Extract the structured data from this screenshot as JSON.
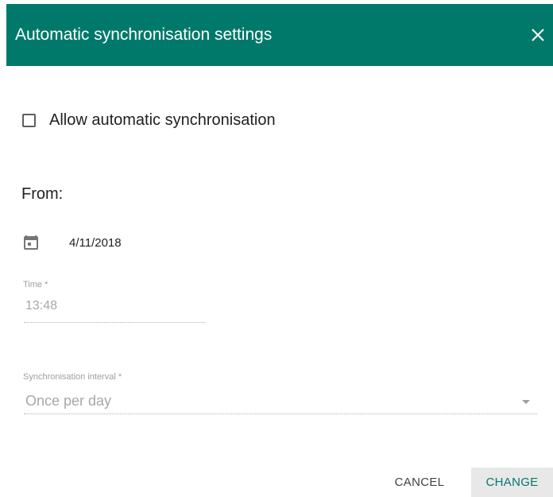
{
  "dialog": {
    "title": "Automatic synchronisation settings",
    "close_icon": "close-icon"
  },
  "auto_sync": {
    "label": "Allow automatic synchronisation",
    "checked": false
  },
  "from": {
    "label": "From:",
    "date_icon": "calendar-icon",
    "date": "4/11/2018"
  },
  "time": {
    "label": "Time *",
    "value": "13:48"
  },
  "interval": {
    "label": "Synchronisation interval *",
    "value": "Once per day"
  },
  "actions": {
    "cancel_label": "CANCEL",
    "change_label": "CHANGE"
  },
  "colors": {
    "header_bg": "#00796b",
    "accent": "#00796b"
  }
}
